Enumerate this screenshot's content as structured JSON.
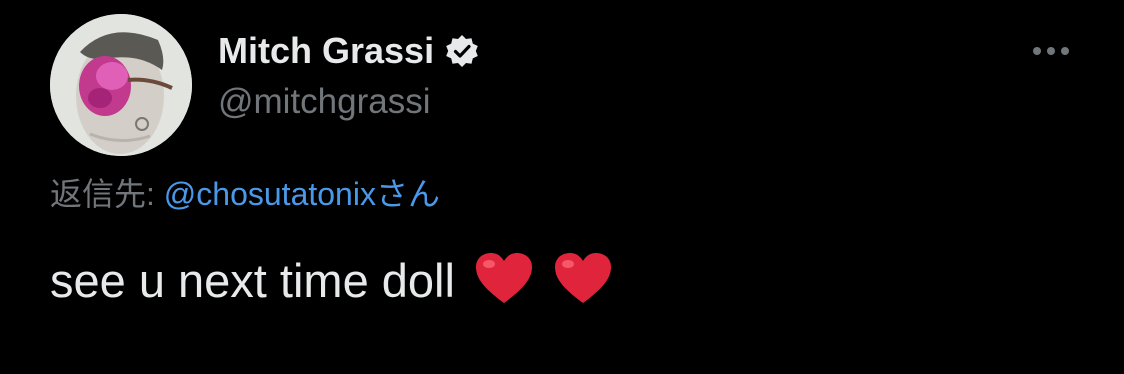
{
  "tweet": {
    "author": {
      "display_name": "Mitch Grassi",
      "handle": "@mitchgrassi",
      "verified": true
    },
    "reply": {
      "prefix": "返信先: ",
      "handle": "@chosutatonix",
      "suffix": "さん"
    },
    "text": "see u next time doll",
    "emojis": [
      "heart-icon",
      "heart-icon"
    ]
  },
  "colors": {
    "background": "#000000",
    "text_primary": "#e7e9ea",
    "text_secondary": "#71767b",
    "link": "#4a99e9",
    "heart": "#e0243b"
  },
  "icons": {
    "verified": "verified-badge-icon",
    "more": "more-icon",
    "heart": "heart-icon"
  }
}
